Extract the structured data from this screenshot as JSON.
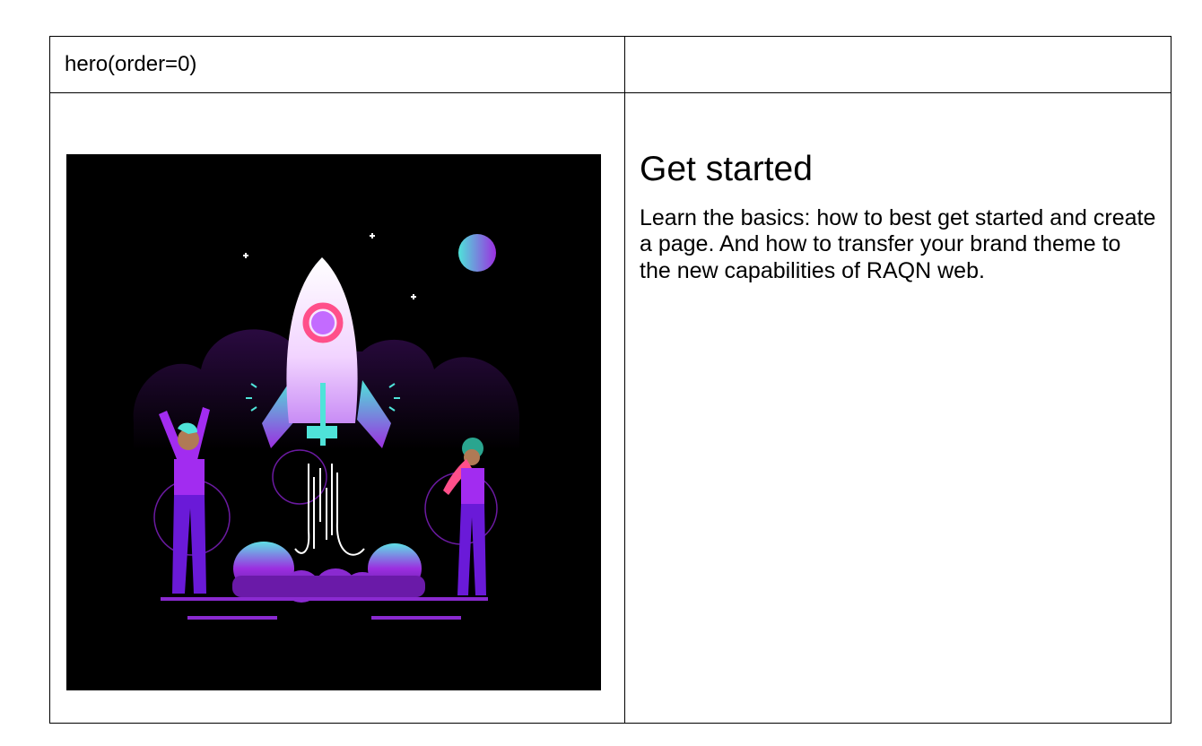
{
  "block": {
    "name": "hero(order=0)"
  },
  "hero": {
    "image_alt": "Rocket launch illustration",
    "title": "Get started",
    "body": "Learn the basics: how to best get started and create a page. And how to transfer your brand theme to the new capabilities of RAQN web."
  },
  "colors": {
    "background": "#ffffff",
    "border": "#000000",
    "image_bg": "#000000",
    "accent_purple": "#9b2fe0",
    "accent_cyan": "#4fe3d9",
    "accent_pink": "#ff4f8a"
  }
}
